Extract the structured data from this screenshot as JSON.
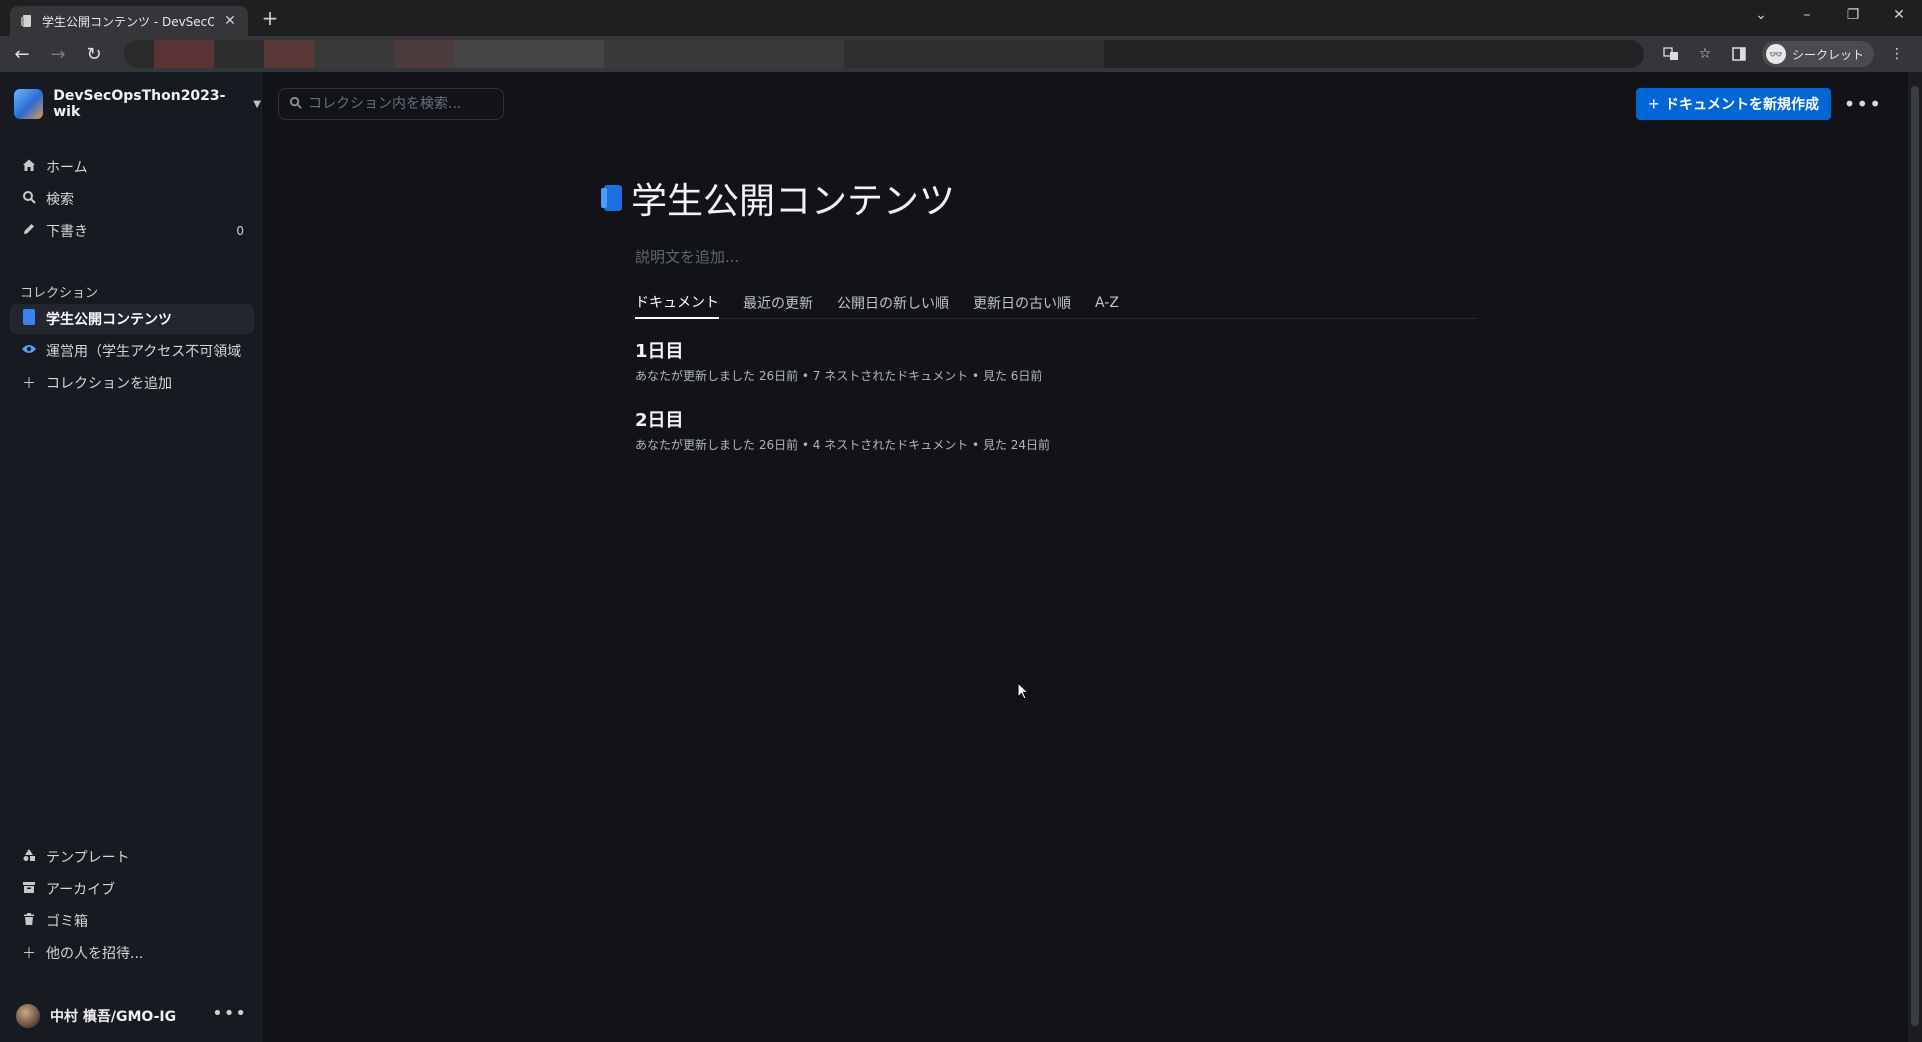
{
  "browser": {
    "tab_title": "学生公開コンテンツ - DevSecOpsTh",
    "incognito_label": "シークレット"
  },
  "sidebar": {
    "team_name": "DevSecOpsThon2023-wik",
    "nav": [
      {
        "label": "ホーム",
        "icon": "home-icon"
      },
      {
        "label": "検索",
        "icon": "search-icon"
      },
      {
        "label": "下書き",
        "icon": "pencil-icon",
        "count": "0"
      }
    ],
    "collections_heading": "コレクション",
    "collections": [
      {
        "label": "学生公開コンテンツ",
        "icon": "collection-icon",
        "active": true
      },
      {
        "label": "運営用（学生アクセス不可領域",
        "icon": "eye-icon"
      },
      {
        "label": "コレクションを追加",
        "icon": "plus-icon"
      }
    ],
    "bottom": [
      {
        "label": "テンプレート",
        "icon": "shapes-icon"
      },
      {
        "label": "アーカイブ",
        "icon": "archive-icon"
      },
      {
        "label": "ゴミ箱",
        "icon": "trash-icon"
      },
      {
        "label": "他の人を招待...",
        "icon": "plus-icon"
      }
    ],
    "user_name": "中村 槙吾/GMO-IG"
  },
  "main": {
    "search_placeholder": "コレクション内を検索...",
    "new_doc_label": "ドキュメントを新規作成",
    "collection_title": "学生公開コンテンツ",
    "description_placeholder": "説明文を追加...",
    "tabs": [
      "ドキュメント",
      "最近の更新",
      "公開日の新しい順",
      "更新日の古い順",
      "A-Z"
    ],
    "documents": [
      {
        "title": "1日目",
        "meta": "あなたが更新しました 26日前 • 7 ネストされたドキュメント • 見た 6日前"
      },
      {
        "title": "2日目",
        "meta": "あなたが更新しました 26日前 • 4 ネストされたドキュメント • 見た 24日前"
      }
    ]
  },
  "colors": {
    "accent": "#0366d6",
    "collection_blue": "#1d6fe0",
    "background": "#111319",
    "sidebar": "#171a21"
  }
}
